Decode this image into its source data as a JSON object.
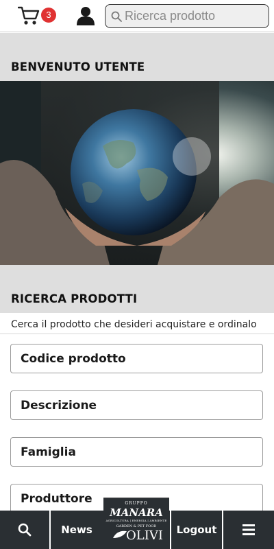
{
  "header": {
    "cart_count": "3",
    "search_placeholder": "Ricerca prodotto"
  },
  "welcome": {
    "title": "BENVENUTO UTENTE"
  },
  "search_section": {
    "title": "RICERCA PRODOTTI",
    "subtitle": "Cerca il prodotto che desideri acquistare e ordinalo",
    "fields": [
      "Codice prodotto",
      "Descrizione",
      "Famiglia",
      "Produttore"
    ]
  },
  "bottom_nav": {
    "news_label": "News",
    "logout_label": "Logout",
    "logo": {
      "group": "GRUPPO",
      "name": "MANARA",
      "tagline": "AGRICOLTURA | ENERGIA | AMBIENTE",
      "sub": "GARDEN & PET FOOD",
      "brand": "OLIVI"
    }
  },
  "colors": {
    "badge": "#e03232",
    "nav_bg": "#2a2f33",
    "section_bg": "#dedede"
  },
  "icons": [
    "cart-icon",
    "user-icon",
    "search-icon",
    "menu-icon"
  ]
}
